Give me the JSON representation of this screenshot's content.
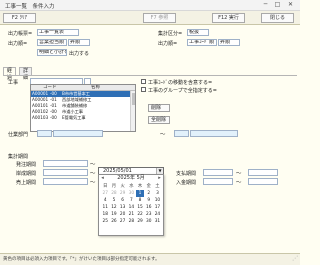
{
  "window": {
    "title": "工事一覧　条件入力",
    "minimize": "─",
    "maximize": "□",
    "close": "✕"
  },
  "toolbar": {
    "clear": "F2 ｸﾘｱ",
    "reference": "F7 参照",
    "execute": "F12 実行",
    "close": "閉じる"
  },
  "header": {
    "output_format_label": "出力帳票=",
    "output_format_value": "工事一覧表",
    "output_order_label": "出力順=",
    "output_order_value1": "営業担当順",
    "output_order_value2": "昇順",
    "page_break_value": "明細と小計を",
    "page_break_suffix": "出力する",
    "aggregate_label": "集計区分=",
    "aggregate_value": "税抜",
    "output_order2_label": "出力順=",
    "output_order2_value1": "工事ｺｰﾄﾞ順",
    "output_order2_value2": "昇順"
  },
  "tabs": [
    "経過",
    "詳細"
  ],
  "koji": {
    "label": "工事",
    "list_header": {
      "code": "コード",
      "name": "名称"
    },
    "items": [
      {
        "code": "A00001",
        "sub": "-00",
        "name": "B市市営基本工"
      },
      {
        "code": "A00001",
        "sub": "-01",
        "name": "西部地域補修工"
      },
      {
        "code": "A00101",
        "sub": "-01",
        "name": "市道舗装補修"
      },
      {
        "code": "A00102",
        "sub": "-00",
        "name": "市道小工事"
      },
      {
        "code": "A00103",
        "sub": "-00",
        "name": "E管電気工事"
      }
    ],
    "check1_label": "工事ｺｰﾄﾞの移動を含意する=",
    "check2_label": "工事のグループで全指定する=",
    "delete_button": "削除",
    "delete_all_button": "全削除"
  },
  "kanri": {
    "label": "仕業部門",
    "tilde": "～"
  },
  "period": {
    "section_label": "集計期間",
    "order_label": "発注期間",
    "completion_label": "岸成期間",
    "sales_label": "売上期間",
    "payment_label": "支払期間",
    "deposit_label": "入金期間",
    "tilde": "～"
  },
  "calendar": {
    "dropdown_value": "2025/05/01",
    "dropdown_arrow": "▼",
    "title": "2025年 5月",
    "prev": "◂",
    "next": "▸",
    "weekdays": [
      "日",
      "月",
      "火",
      "水",
      "木",
      "金",
      "土"
    ],
    "days": [
      "27",
      "28",
      "29",
      "30",
      "1",
      "2",
      "3",
      "4",
      "5",
      "6",
      "7",
      "8",
      "9",
      "10",
      "11",
      "12",
      "13",
      "14",
      "15",
      "16",
      "17",
      "18",
      "19",
      "20",
      "21",
      "22",
      "23",
      "24",
      "25",
      "26",
      "27",
      "28",
      "29",
      "30",
      "31"
    ],
    "selected_day": "1"
  },
  "status": {
    "text": "黄色の項目は必須入力項目です。「*」がけいた項目は部分指定可能されます。"
  }
}
